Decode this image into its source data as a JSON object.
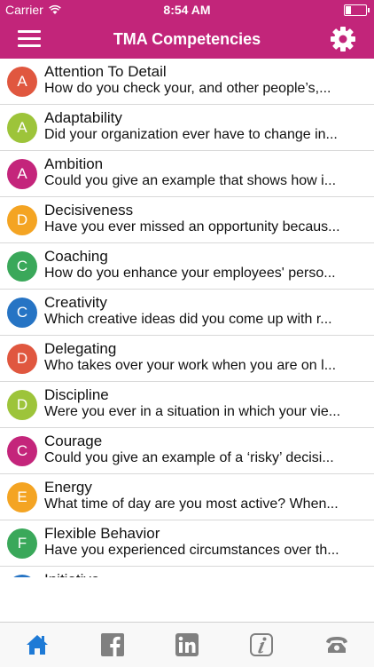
{
  "status": {
    "carrier": "Carrier",
    "time": "8:54 AM"
  },
  "navbar": {
    "title": "TMA Competencies",
    "menu_icon": "menu-icon",
    "settings_icon": "gear-icon"
  },
  "colors": {
    "brand": "#c2257a"
  },
  "items": [
    {
      "letter": "A",
      "color": "#e0573f",
      "name": "Attention To Detail",
      "desc": "How do you check your, and other people’s,..."
    },
    {
      "letter": "A",
      "color": "#9dc43a",
      "name": "Adaptability",
      "desc": "Did your organization ever have to change in..."
    },
    {
      "letter": "A",
      "color": "#c4257b",
      "name": "Ambition",
      "desc": "Could you give an example that shows how i..."
    },
    {
      "letter": "D",
      "color": "#f4a423",
      "name": "Decisiveness",
      "desc": "Have you ever missed an opportunity becaus..."
    },
    {
      "letter": "C",
      "color": "#3aa85a",
      "name": "Coaching",
      "desc": "How do you enhance your employees' perso..."
    },
    {
      "letter": "C",
      "color": "#2674c4",
      "name": "Creativity",
      "desc": "Which creative ideas did you come up with r..."
    },
    {
      "letter": "D",
      "color": "#e0573f",
      "name": "Delegating",
      "desc": "Who takes over your work when you are on l..."
    },
    {
      "letter": "D",
      "color": "#9dc43a",
      "name": "Discipline",
      "desc": "Were you ever in a situation in which your vie..."
    },
    {
      "letter": "C",
      "color": "#c4257b",
      "name": "Courage",
      "desc": "Could you give an example of a ‘risky’ decisi..."
    },
    {
      "letter": "E",
      "color": "#f4a423",
      "name": "Energy",
      "desc": "What time of day are you most active? When..."
    },
    {
      "letter": "F",
      "color": "#3aa85a",
      "name": "Flexible Behavior",
      "desc": "Have you experienced circumstances over th..."
    },
    {
      "letter": "I",
      "color": "#2674c4",
      "name": "Initiative",
      "desc": ""
    }
  ],
  "tabs": [
    {
      "icon": "home-icon"
    },
    {
      "icon": "facebook-icon"
    },
    {
      "icon": "linkedin-icon"
    },
    {
      "icon": "info-icon"
    },
    {
      "icon": "phone-icon"
    }
  ]
}
